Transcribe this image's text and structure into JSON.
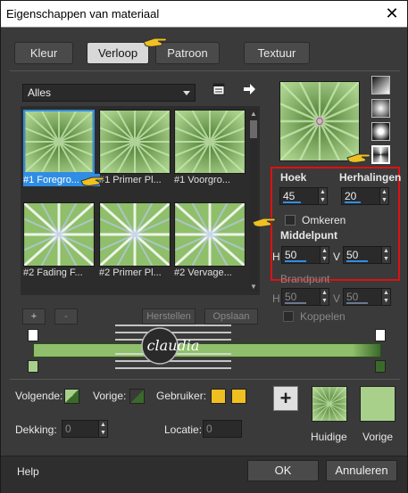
{
  "window": {
    "title": "Eigenschappen van materiaal",
    "close_glyph": "✕"
  },
  "tabs": [
    {
      "label": "Kleur"
    },
    {
      "label": "Verloop"
    },
    {
      "label": "Patroon"
    },
    {
      "label": "Textuur"
    }
  ],
  "gallery": {
    "category_value": "Alles",
    "items": [
      {
        "label": "#1 Foregro..."
      },
      {
        "label": "#1 Primer Pl..."
      },
      {
        "label": "#1 Voorgro..."
      },
      {
        "label": "#2 Fading F..."
      },
      {
        "label": "#2 Primer Pl..."
      },
      {
        "label": "#2 Vervage..."
      }
    ],
    "add_label": "+",
    "remove_label": "-",
    "reset_label": "Herstellen",
    "save_label": "Opslaan"
  },
  "props": {
    "angle_label": "Hoek",
    "angle_value": "45",
    "repeats_label": "Herhalingen",
    "repeats_value": "20",
    "invert_label": "Omkeren",
    "center_label": "Middelpunt",
    "center_h_label": "H",
    "center_h_value": "50",
    "center_v_label": "V",
    "center_v_value": "50",
    "focal_label": "Brandpunt",
    "focal_h_label": "H",
    "focal_h_value": "50",
    "focal_v_label": "V",
    "focal_v_value": "50",
    "link_label": "Koppelen"
  },
  "bottom": {
    "foreground_label": "Volgende:",
    "background_label": "Vorige:",
    "user_label": "Gebruiker:",
    "opacity_label": "Dekking:",
    "opacity_value": "0",
    "location_label": "Locatie:",
    "location_value": "0",
    "current_label": "Huidige",
    "previous_label": "Vorige",
    "add_glyph": "+"
  },
  "footer": {
    "help_label": "Help",
    "ok_label": "OK",
    "cancel_label": "Annuleren"
  },
  "watermark": {
    "text": "claudia"
  },
  "colors": {
    "accent": "#2f8de4",
    "highlight_box": "#e01010",
    "gradient_light": "#a8d08a",
    "gradient_dark": "#3a6a2a",
    "user_swatch": "#f0c020"
  }
}
